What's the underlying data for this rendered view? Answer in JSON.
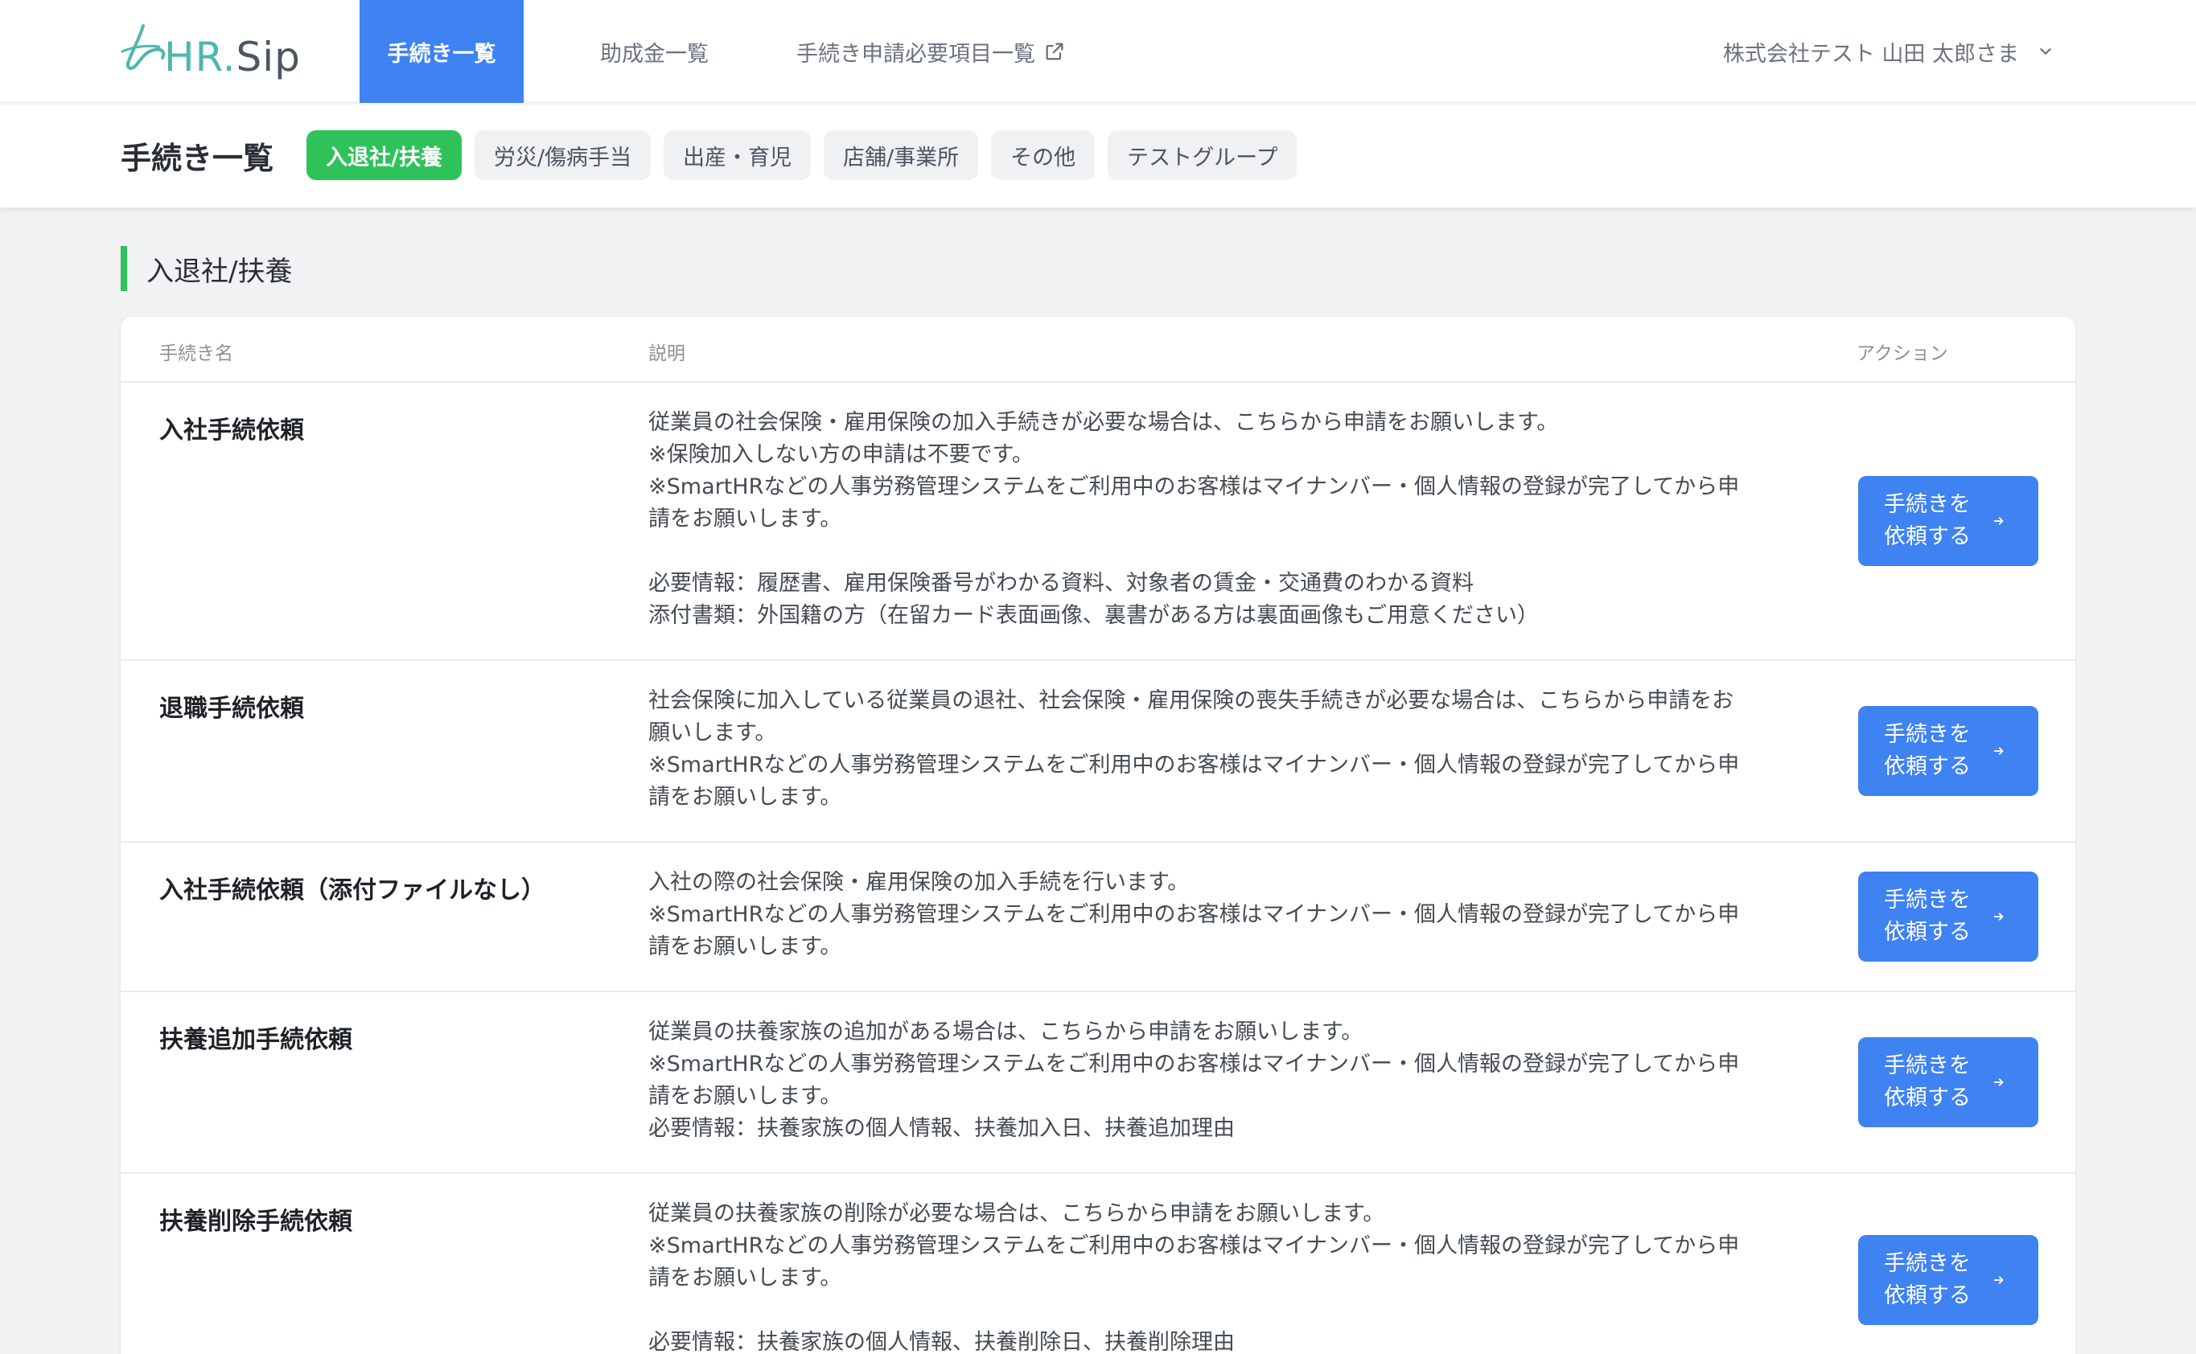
{
  "brand": {
    "logo_hr": "HR",
    "logo_dot": ".",
    "logo_sip": "Sip"
  },
  "nav": {
    "tabs": [
      {
        "label": "手続き一覧"
      },
      {
        "label": "助成金一覧"
      },
      {
        "label": "手続き申請必要項目一覧"
      }
    ],
    "user": "株式会社テスト 山田 太郎さま"
  },
  "page": {
    "title": "手続き一覧",
    "categories": [
      "入退社/扶養",
      "労災/傷病手当",
      "出産・育児",
      "店舗/事業所",
      "その他",
      "テストグループ"
    ]
  },
  "section": {
    "title": "入退社/扶養",
    "columns": {
      "name": "手続き名",
      "description": "説明",
      "action": "アクション"
    },
    "button_line1": "手続きを",
    "button_line2": "依頼する",
    "rows": [
      {
        "name": "入社手続依頼",
        "lines": [
          "従業員の社会保険・雇用保険の加入手続きが必要な場合は、こちらから申請をお願いします。",
          "※保険加入しない方の申請は不要です。",
          "※SmartHRなどの人事労務管理システムをご利用中のお客様はマイナンバー・個人情報の登録が完了してから申",
          "請をお願いします。",
          "",
          "必要情報：履歴書、雇用保険番号がわかる資料、対象者の賃金・交通費のわかる資料",
          "添付書類：外国籍の方（在留カード表面画像、裏書がある方は裏面画像もご用意ください）"
        ]
      },
      {
        "name": "退職手続依頼",
        "lines": [
          "社会保険に加入している従業員の退社、社会保険・雇用保険の喪失手続きが必要な場合は、こちらから申請をお",
          "願いします。",
          "※SmartHRなどの人事労務管理システムをご利用中のお客様はマイナンバー・個人情報の登録が完了してから申",
          "請をお願いします。"
        ]
      },
      {
        "name": "入社手続依頼（添付ファイルなし）",
        "lines": [
          "入社の際の社会保険・雇用保険の加入手続を行います。",
          "※SmartHRなどの人事労務管理システムをご利用中のお客様はマイナンバー・個人情報の登録が完了してから申",
          "請をお願いします。"
        ]
      },
      {
        "name": "扶養追加手続依頼",
        "lines": [
          "従業員の扶養家族の追加がある場合は、こちらから申請をお願いします。",
          "※SmartHRなどの人事労務管理システムをご利用中のお客様はマイナンバー・個人情報の登録が完了してから申",
          "請をお願いします。",
          "必要情報：扶養家族の個人情報、扶養加入日、扶養追加理由"
        ]
      },
      {
        "name": "扶養削除手続依頼",
        "lines": [
          "従業員の扶養家族の削除が必要な場合は、こちらから申請をお願いします。",
          "※SmartHRなどの人事労務管理システムをご利用中のお客様はマイナンバー・個人情報の登録が完了してから申",
          "請をお願いします。",
          "",
          "必要情報：扶養家族の個人情報、扶養削除日、扶養削除理由"
        ]
      }
    ]
  }
}
